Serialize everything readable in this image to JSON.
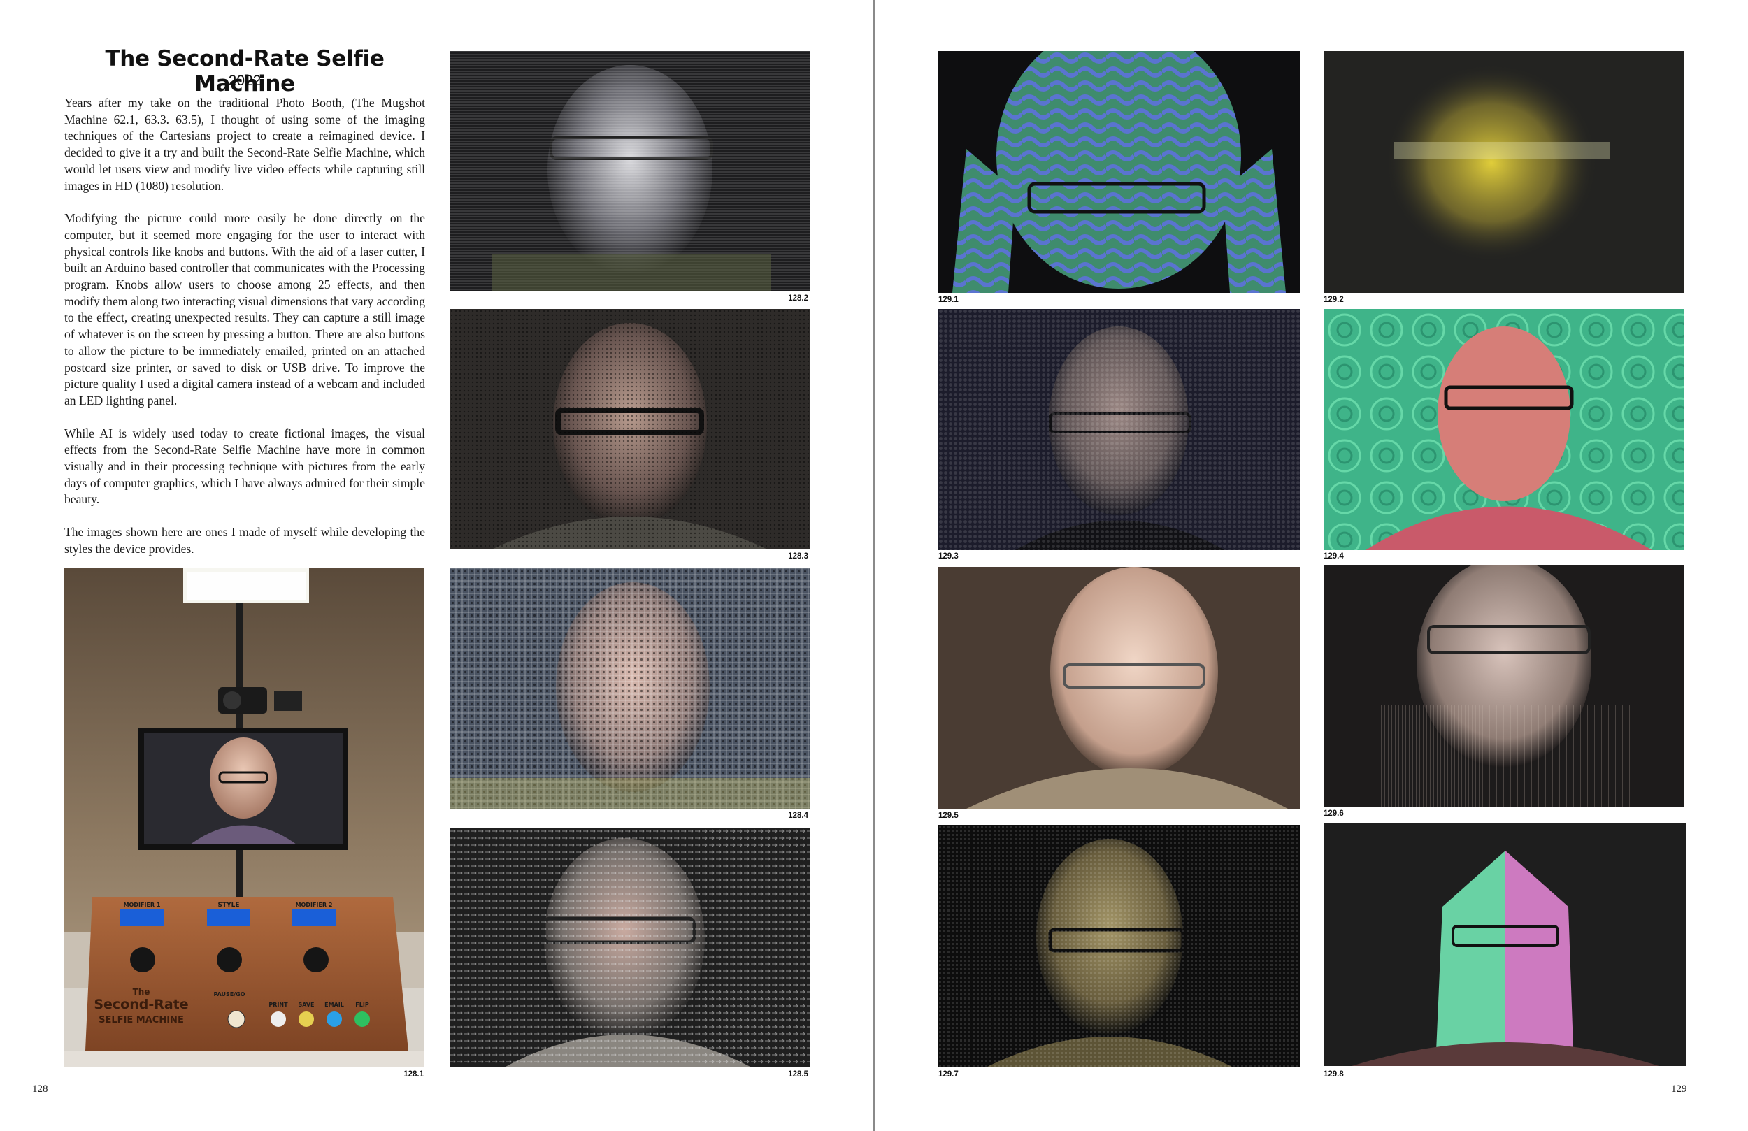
{
  "left_page": {
    "title": "The Second-Rate Selfie Machine",
    "year": "2022",
    "paragraphs": [
      "Years after my take on the traditional Photo Booth, (The Mugshot Machine 62.1, 63.3. 63.5), I thought of using some of the imaging techniques of the Cartesians project to create a reimagined device. I decided to give it a try and built the Second-Rate Selfie Machine, which would let users view and modify live video effects while capturing still images in HD (1080) resolution.",
      "Modifying the picture could more easily be done directly on the computer, but it seemed more engaging for the user to interact with physical controls like knobs and buttons. With the aid of a laser cutter, I built an Arduino based controller that communicates with the Processing program. Knobs allow users to choose among 25 effects, and then modify them along two interacting visual dimensions that vary according to the effect, creating unexpected results. They can capture a still image of whatever is on the screen by pressing a button. There are also buttons to allow the picture to be immediately emailed, printed on an attached postcard size printer, or saved to disk or USB drive. To improve the picture quality I used a digital camera instead of a webcam and included an LED lighting panel.",
      "While AI is widely used today to create fictional images, the visual effects from the Second-Rate Selfie Machine have more in common visually and in their processing technique with pictures from the early days of computer graphics, which I have always admired for their simple beauty.",
      "The images shown here are ones I made of myself while developing the styles the device provides."
    ],
    "page_number": "128",
    "captions": {
      "c128_1": "128.1",
      "c128_2": "128.2",
      "c128_3": "128.3",
      "c128_4": "128.4",
      "c128_5": "128.5"
    },
    "machine_labels": {
      "brand_line1": "The",
      "brand_line2": "Second-Rate",
      "brand_line3": "SELFIE MACHINE",
      "modifier_1": "MODIFIER 1",
      "style": "STYLE",
      "modifier_2": "MODIFIER 2",
      "pause_go": "PAUSE/GO",
      "print": "PRINT",
      "save": "SAVE",
      "email": "EMAIL",
      "flip": "FLIP"
    }
  },
  "right_page": {
    "page_number": "129",
    "captions": {
      "c129_1": "129.1",
      "c129_2": "129.2",
      "c129_3": "129.3",
      "c129_4": "129.4",
      "c129_5": "129.5",
      "c129_6": "129.6",
      "c129_7": "129.7",
      "c129_8": "129.8"
    }
  },
  "colors": {
    "paper": "#ffffff",
    "gutter": "#8a8a8a",
    "wood": "#a0603a",
    "lcd_blue": "#2b6fe0",
    "effect_green": "#3fbf8a",
    "effect_pink": "#d06aa8",
    "effect_yellow": "#c9b43a",
    "effect_blue": "#4f6fd0"
  }
}
